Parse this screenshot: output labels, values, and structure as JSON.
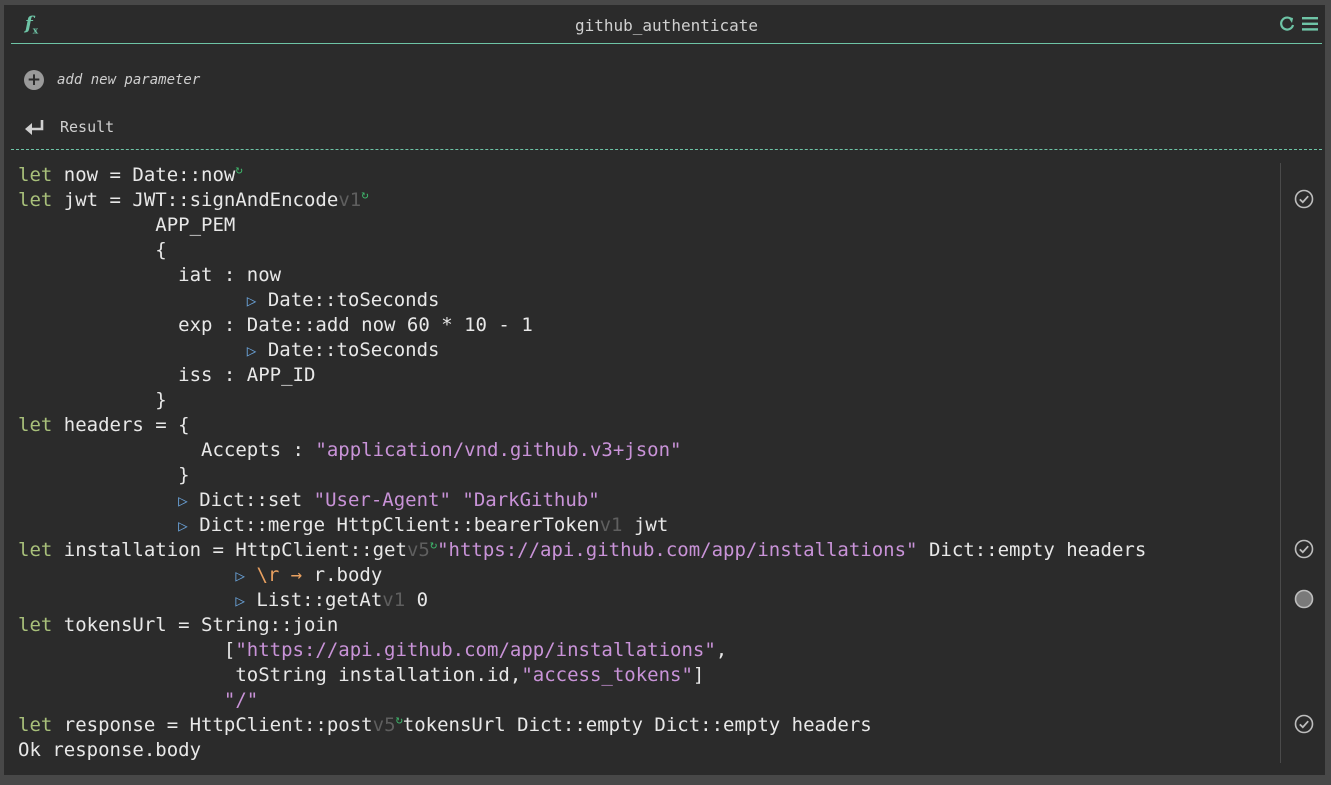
{
  "window": {
    "title": "github_authenticate",
    "left_icon": "function-fx-icon",
    "right_icons": [
      "refresh-icon",
      "menu-icon"
    ]
  },
  "params": {
    "add_label": "add new parameter"
  },
  "result": {
    "label": "Result"
  },
  "code": {
    "lines": [
      "let now = Date::now",
      "let jwt = JWT::signAndEncode v1",
      "APP_PEM",
      "{",
      "iat : now",
      "▷ Date::toSeconds",
      "exp : Date::add now 60 * 10 - 1",
      "▷ Date::toSeconds",
      "iss : APP_ID",
      "}",
      "let headers = {",
      "Accepts : \"application/vnd.github.v3+json\"",
      "}",
      "▷ Dict::set \"User-Agent\" \"DarkGithub\"",
      "▷ Dict::merge HttpClient::bearerToken v1 jwt",
      "let installation = HttpClient::get v5 \"https://api.github.com/app/installations\" Dict::empty headers",
      "▷ \\r → r.body",
      "▷ List::getAt v1 0",
      "let tokensUrl = String::join",
      "[\"https://api.github.com/app/installations\",",
      "toString installation.id,\"access_tokens\"]",
      "\"/\"",
      "let response = HttpClient::post v5 tokensUrl Dict::empty Dict::empty headers",
      "Ok response.body"
    ],
    "status_indicators": [
      "check-circle-icon",
      "check-circle-icon",
      "loading-dot-icon",
      "check-circle-icon"
    ]
  },
  "colors": {
    "background": "#2b2b2b",
    "accent": "#6ec4a6",
    "keyword": "#a8c07a",
    "string": "#c993d8",
    "version": "#5f5f5f",
    "text": "#e8e8e8"
  }
}
